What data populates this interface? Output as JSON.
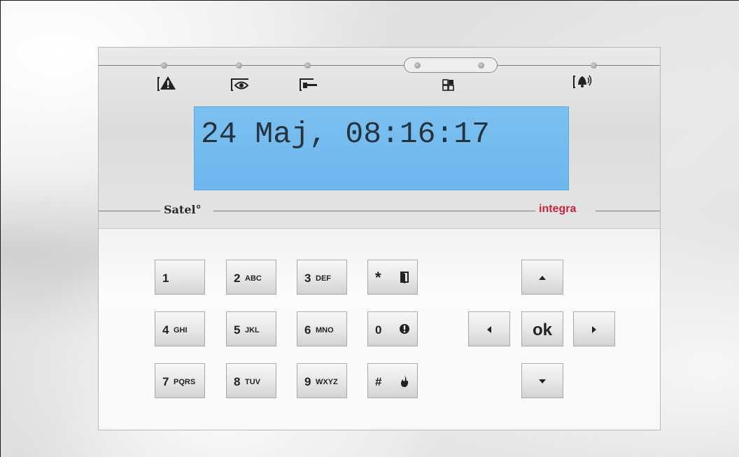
{
  "display": {
    "lcd_text": "24 Maj, 08:16:17"
  },
  "branding": {
    "left": "Satel°",
    "right": "integra"
  },
  "indicators": [
    {
      "name": "alarm-icon"
    },
    {
      "name": "monitoring-eye-icon"
    },
    {
      "name": "service-key-icon"
    },
    {
      "name": "partitions-icon"
    },
    {
      "name": "trouble-bell-icon"
    }
  ],
  "keys": {
    "k1": {
      "main": "1",
      "sub": ""
    },
    "k2": {
      "main": "2",
      "sub": "ABC"
    },
    "k3": {
      "main": "3",
      "sub": "DEF"
    },
    "kstar": {
      "main": "*",
      "icon": "arm-door-icon"
    },
    "k4": {
      "main": "4",
      "sub": "GHI"
    },
    "k5": {
      "main": "5",
      "sub": "JKL"
    },
    "k6": {
      "main": "6",
      "sub": "MNO"
    },
    "k0": {
      "main": "0",
      "icon": "alert-exclamation-icon"
    },
    "k7": {
      "main": "7",
      "sub": "PQRS"
    },
    "k8": {
      "main": "8",
      "sub": "TUV"
    },
    "k9": {
      "main": "9",
      "sub": "WXYZ"
    },
    "khash": {
      "main": "#",
      "icon": "fire-icon"
    }
  },
  "nav": {
    "ok": "ok",
    "up_icon": "arrow-up-icon",
    "down_icon": "arrow-down-icon",
    "left_icon": "arrow-left-icon",
    "right_icon": "arrow-right-icon"
  }
}
